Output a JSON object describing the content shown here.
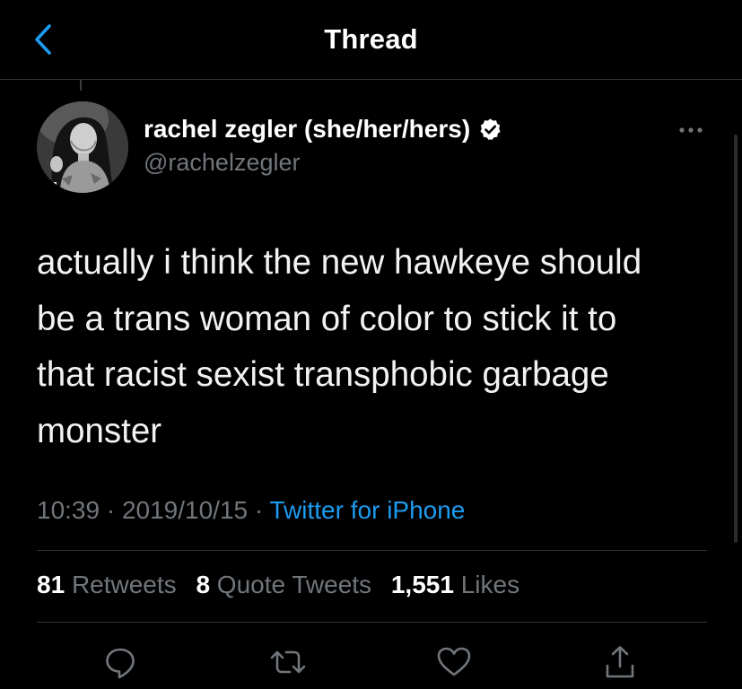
{
  "header": {
    "title": "Thread",
    "back_icon": "chevron-left-icon"
  },
  "author": {
    "name": "rachel zegler (she/her/hers)",
    "handle": "@rachelzegler",
    "verified": true
  },
  "tweet": {
    "text": "actually i think the new hawkeye should\nbe a trans woman of color to stick it to\nthat racist sexist transphobic garbage\nmonster"
  },
  "meta": {
    "time": "10:39",
    "separator": "·",
    "date": "2019/10/15",
    "source": "Twitter for iPhone"
  },
  "stats": {
    "retweets_count": "81",
    "retweets_label": "Retweets",
    "quotes_count": "8",
    "quotes_label": "Quote Tweets",
    "likes_count": "1,551",
    "likes_label": "Likes"
  },
  "actions": [
    "reply-icon",
    "retweet-icon",
    "like-icon",
    "share-icon"
  ],
  "colors": {
    "background": "#000000",
    "text": "#E7E9EA",
    "secondary": "#71767B",
    "accent": "#1D9BF0",
    "divider": "#2F3336"
  }
}
